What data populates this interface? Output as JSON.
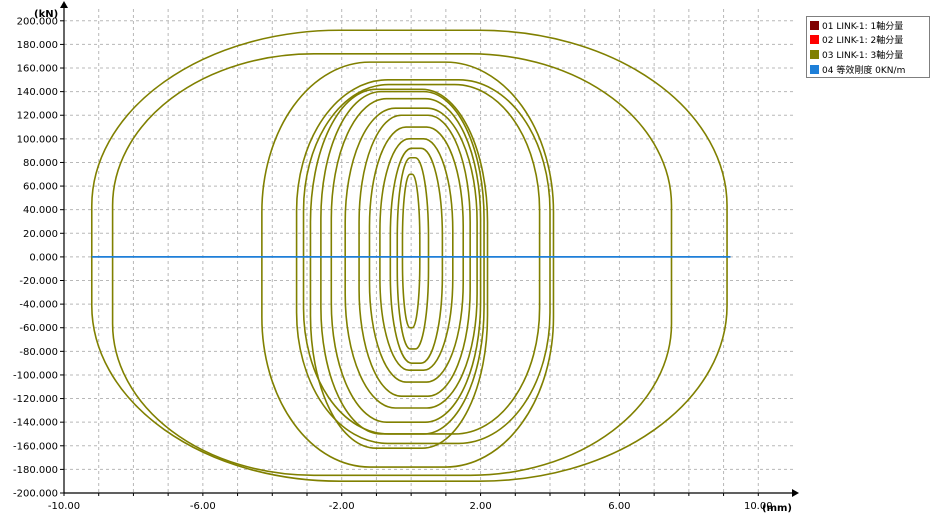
{
  "chart_data": {
    "type": "line",
    "xlabel": "(mm)",
    "ylabel": "(kN)",
    "xlim": [
      -10,
      11
    ],
    "ylim": [
      -200,
      210
    ],
    "x_ticks": [
      -10,
      -6,
      -2,
      2,
      6,
      10
    ],
    "x_tick_labels": [
      "-10.00",
      "-6.00",
      "-2.00",
      "2.00",
      "6.00",
      "10.00"
    ],
    "y_ticks": [
      200,
      180,
      160,
      140,
      120,
      100,
      80,
      60,
      40,
      20,
      0,
      -20,
      -40,
      -60,
      -80,
      -100,
      -120,
      -140,
      -160,
      -180,
      -200
    ],
    "y_tick_labels": [
      "200.000",
      "180.000",
      "160.000",
      "140.000",
      "120.000",
      "100.000",
      "80.000",
      "60.000",
      "40.000",
      "20.000",
      "0.000",
      "-20.000",
      "-40.000",
      "-60.000",
      "-80.000",
      "-100.000",
      "-120.000",
      "-140.000",
      "-160.000",
      "-180.000",
      "-200.000"
    ],
    "grid": true,
    "legend_position": "top-right",
    "series": [
      {
        "name": "01 LINK-1: 1軸分量",
        "color": "#800000",
        "loops": []
      },
      {
        "name": "02 LINK-1: 2軸分量",
        "color": "#ff0000",
        "loops": []
      },
      {
        "name": "03 LINK-1: 3軸分量",
        "color": "#808000",
        "loops": [
          {
            "xmin": -9.2,
            "xmax": 9.1,
            "ymin": -190,
            "ymax": 192,
            "r": 0.78
          },
          {
            "xmin": -8.6,
            "xmax": 7.5,
            "ymin": -185,
            "ymax": 172,
            "r": 0.72
          },
          {
            "xmin": -4.3,
            "xmax": 4.1,
            "ymin": -178,
            "ymax": 165,
            "r": 0.74
          },
          {
            "xmin": -3.3,
            "xmax": 4.0,
            "ymin": -158,
            "ymax": 150,
            "r": 0.72
          },
          {
            "xmin": -3.1,
            "xmax": 3.7,
            "ymin": -150,
            "ymax": 146,
            "r": 0.72
          },
          {
            "xmin": -2.9,
            "xmax": 2.2,
            "ymin": -162,
            "ymax": 142,
            "r": 0.74
          },
          {
            "xmin": -2.6,
            "xmax": 2.1,
            "ymin": -150,
            "ymax": 140,
            "r": 0.74
          },
          {
            "xmin": -2.3,
            "xmax": 2.0,
            "ymin": -140,
            "ymax": 134,
            "r": 0.74
          },
          {
            "xmin": -1.9,
            "xmax": 1.9,
            "ymin": -128,
            "ymax": 126,
            "r": 0.76
          },
          {
            "xmin": -1.5,
            "xmax": 1.7,
            "ymin": -118,
            "ymax": 120,
            "r": 0.76
          },
          {
            "xmin": -1.2,
            "xmax": 1.5,
            "ymin": -106,
            "ymax": 110,
            "r": 0.78
          },
          {
            "xmin": -0.9,
            "xmax": 1.2,
            "ymin": -96,
            "ymax": 100,
            "r": 0.8
          },
          {
            "xmin": -0.6,
            "xmax": 0.9,
            "ymin": -90,
            "ymax": 92,
            "r": 0.82
          },
          {
            "xmin": -0.4,
            "xmax": 0.5,
            "ymin": -78,
            "ymax": 84,
            "r": 0.84
          },
          {
            "xmin": -0.25,
            "xmax": 0.25,
            "ymin": -60,
            "ymax": 70,
            "r": 0.86
          }
        ]
      },
      {
        "name": "04 等效剛度 0KN/m",
        "color": "#1e7fd8",
        "x": [
          -9.2,
          9.2
        ],
        "y": [
          0,
          0
        ]
      }
    ]
  }
}
